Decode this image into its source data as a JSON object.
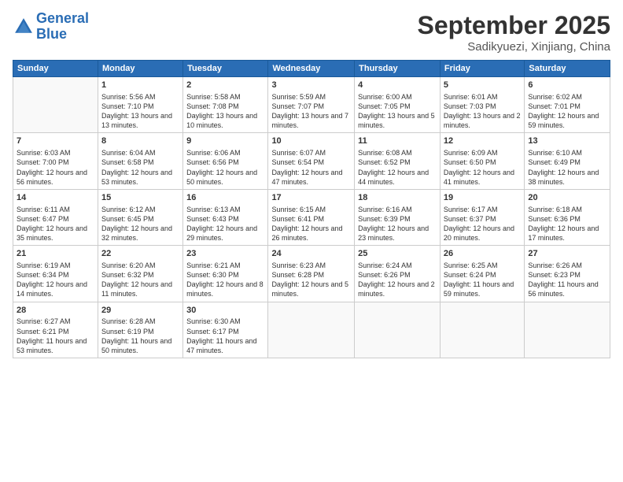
{
  "logo": {
    "line1": "General",
    "line2": "Blue"
  },
  "title": "September 2025",
  "location": "Sadikyuezi, Xinjiang, China",
  "days_header": [
    "Sunday",
    "Monday",
    "Tuesday",
    "Wednesday",
    "Thursday",
    "Friday",
    "Saturday"
  ],
  "weeks": [
    [
      {
        "num": "",
        "sunrise": "",
        "sunset": "",
        "daylight": ""
      },
      {
        "num": "1",
        "sunrise": "Sunrise: 5:56 AM",
        "sunset": "Sunset: 7:10 PM",
        "daylight": "Daylight: 13 hours and 13 minutes."
      },
      {
        "num": "2",
        "sunrise": "Sunrise: 5:58 AM",
        "sunset": "Sunset: 7:08 PM",
        "daylight": "Daylight: 13 hours and 10 minutes."
      },
      {
        "num": "3",
        "sunrise": "Sunrise: 5:59 AM",
        "sunset": "Sunset: 7:07 PM",
        "daylight": "Daylight: 13 hours and 7 minutes."
      },
      {
        "num": "4",
        "sunrise": "Sunrise: 6:00 AM",
        "sunset": "Sunset: 7:05 PM",
        "daylight": "Daylight: 13 hours and 5 minutes."
      },
      {
        "num": "5",
        "sunrise": "Sunrise: 6:01 AM",
        "sunset": "Sunset: 7:03 PM",
        "daylight": "Daylight: 13 hours and 2 minutes."
      },
      {
        "num": "6",
        "sunrise": "Sunrise: 6:02 AM",
        "sunset": "Sunset: 7:01 PM",
        "daylight": "Daylight: 12 hours and 59 minutes."
      }
    ],
    [
      {
        "num": "7",
        "sunrise": "Sunrise: 6:03 AM",
        "sunset": "Sunset: 7:00 PM",
        "daylight": "Daylight: 12 hours and 56 minutes."
      },
      {
        "num": "8",
        "sunrise": "Sunrise: 6:04 AM",
        "sunset": "Sunset: 6:58 PM",
        "daylight": "Daylight: 12 hours and 53 minutes."
      },
      {
        "num": "9",
        "sunrise": "Sunrise: 6:06 AM",
        "sunset": "Sunset: 6:56 PM",
        "daylight": "Daylight: 12 hours and 50 minutes."
      },
      {
        "num": "10",
        "sunrise": "Sunrise: 6:07 AM",
        "sunset": "Sunset: 6:54 PM",
        "daylight": "Daylight: 12 hours and 47 minutes."
      },
      {
        "num": "11",
        "sunrise": "Sunrise: 6:08 AM",
        "sunset": "Sunset: 6:52 PM",
        "daylight": "Daylight: 12 hours and 44 minutes."
      },
      {
        "num": "12",
        "sunrise": "Sunrise: 6:09 AM",
        "sunset": "Sunset: 6:50 PM",
        "daylight": "Daylight: 12 hours and 41 minutes."
      },
      {
        "num": "13",
        "sunrise": "Sunrise: 6:10 AM",
        "sunset": "Sunset: 6:49 PM",
        "daylight": "Daylight: 12 hours and 38 minutes."
      }
    ],
    [
      {
        "num": "14",
        "sunrise": "Sunrise: 6:11 AM",
        "sunset": "Sunset: 6:47 PM",
        "daylight": "Daylight: 12 hours and 35 minutes."
      },
      {
        "num": "15",
        "sunrise": "Sunrise: 6:12 AM",
        "sunset": "Sunset: 6:45 PM",
        "daylight": "Daylight: 12 hours and 32 minutes."
      },
      {
        "num": "16",
        "sunrise": "Sunrise: 6:13 AM",
        "sunset": "Sunset: 6:43 PM",
        "daylight": "Daylight: 12 hours and 29 minutes."
      },
      {
        "num": "17",
        "sunrise": "Sunrise: 6:15 AM",
        "sunset": "Sunset: 6:41 PM",
        "daylight": "Daylight: 12 hours and 26 minutes."
      },
      {
        "num": "18",
        "sunrise": "Sunrise: 6:16 AM",
        "sunset": "Sunset: 6:39 PM",
        "daylight": "Daylight: 12 hours and 23 minutes."
      },
      {
        "num": "19",
        "sunrise": "Sunrise: 6:17 AM",
        "sunset": "Sunset: 6:37 PM",
        "daylight": "Daylight: 12 hours and 20 minutes."
      },
      {
        "num": "20",
        "sunrise": "Sunrise: 6:18 AM",
        "sunset": "Sunset: 6:36 PM",
        "daylight": "Daylight: 12 hours and 17 minutes."
      }
    ],
    [
      {
        "num": "21",
        "sunrise": "Sunrise: 6:19 AM",
        "sunset": "Sunset: 6:34 PM",
        "daylight": "Daylight: 12 hours and 14 minutes."
      },
      {
        "num": "22",
        "sunrise": "Sunrise: 6:20 AM",
        "sunset": "Sunset: 6:32 PM",
        "daylight": "Daylight: 12 hours and 11 minutes."
      },
      {
        "num": "23",
        "sunrise": "Sunrise: 6:21 AM",
        "sunset": "Sunset: 6:30 PM",
        "daylight": "Daylight: 12 hours and 8 minutes."
      },
      {
        "num": "24",
        "sunrise": "Sunrise: 6:23 AM",
        "sunset": "Sunset: 6:28 PM",
        "daylight": "Daylight: 12 hours and 5 minutes."
      },
      {
        "num": "25",
        "sunrise": "Sunrise: 6:24 AM",
        "sunset": "Sunset: 6:26 PM",
        "daylight": "Daylight: 12 hours and 2 minutes."
      },
      {
        "num": "26",
        "sunrise": "Sunrise: 6:25 AM",
        "sunset": "Sunset: 6:24 PM",
        "daylight": "Daylight: 11 hours and 59 minutes."
      },
      {
        "num": "27",
        "sunrise": "Sunrise: 6:26 AM",
        "sunset": "Sunset: 6:23 PM",
        "daylight": "Daylight: 11 hours and 56 minutes."
      }
    ],
    [
      {
        "num": "28",
        "sunrise": "Sunrise: 6:27 AM",
        "sunset": "Sunset: 6:21 PM",
        "daylight": "Daylight: 11 hours and 53 minutes."
      },
      {
        "num": "29",
        "sunrise": "Sunrise: 6:28 AM",
        "sunset": "Sunset: 6:19 PM",
        "daylight": "Daylight: 11 hours and 50 minutes."
      },
      {
        "num": "30",
        "sunrise": "Sunrise: 6:30 AM",
        "sunset": "Sunset: 6:17 PM",
        "daylight": "Daylight: 11 hours and 47 minutes."
      },
      {
        "num": "",
        "sunrise": "",
        "sunset": "",
        "daylight": ""
      },
      {
        "num": "",
        "sunrise": "",
        "sunset": "",
        "daylight": ""
      },
      {
        "num": "",
        "sunrise": "",
        "sunset": "",
        "daylight": ""
      },
      {
        "num": "",
        "sunrise": "",
        "sunset": "",
        "daylight": ""
      }
    ]
  ]
}
